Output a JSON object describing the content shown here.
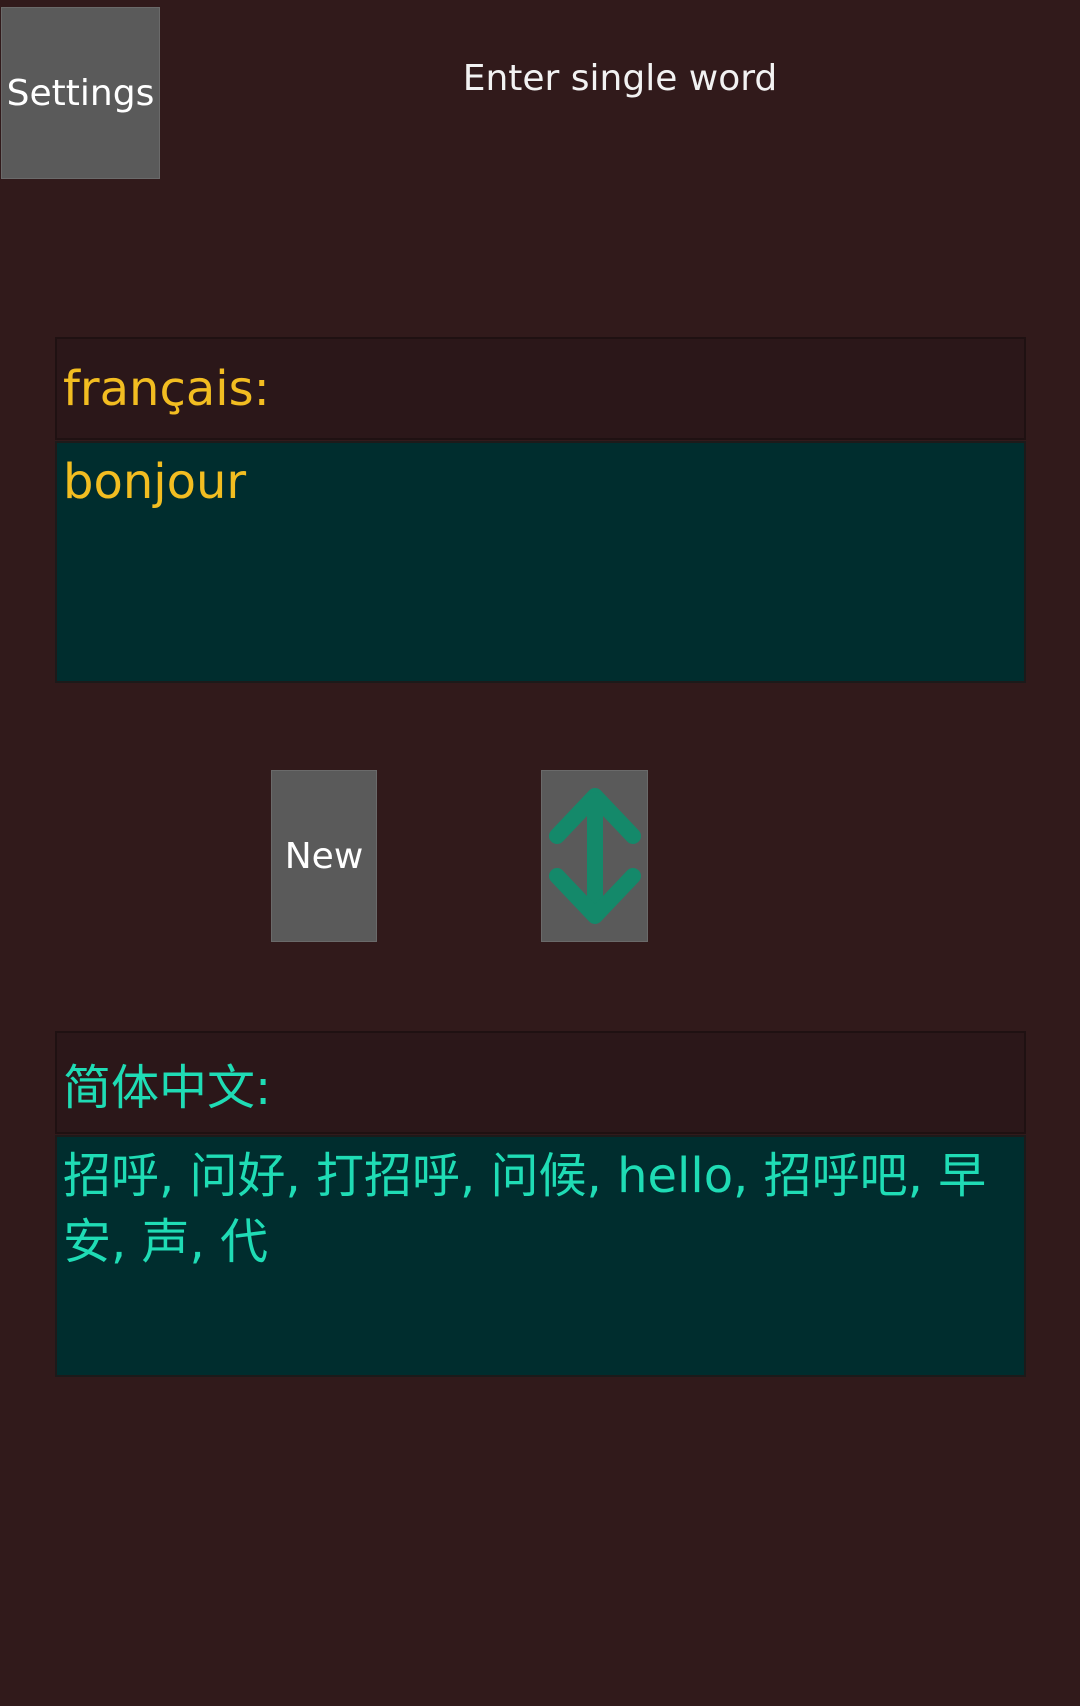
{
  "header": {
    "settings_label": "Settings",
    "hint": "Enter single word"
  },
  "source": {
    "language_label": "français:",
    "text": "bonjour"
  },
  "actions": {
    "new_label": "New",
    "swap_icon": "swap-vertical-arrows",
    "swap_icon_color": "#14896a"
  },
  "target": {
    "language_label": "简体中文:",
    "text": "招呼, 问好, 打招呼, 问候, hello, 招呼吧, 早安, 声, 代"
  },
  "colors": {
    "background": "#311a1b",
    "source_text": "#f2bd21",
    "target_text": "#1fdcb5",
    "text_area_bg": "#002d2e",
    "button_bg": "#5a5a5a"
  }
}
